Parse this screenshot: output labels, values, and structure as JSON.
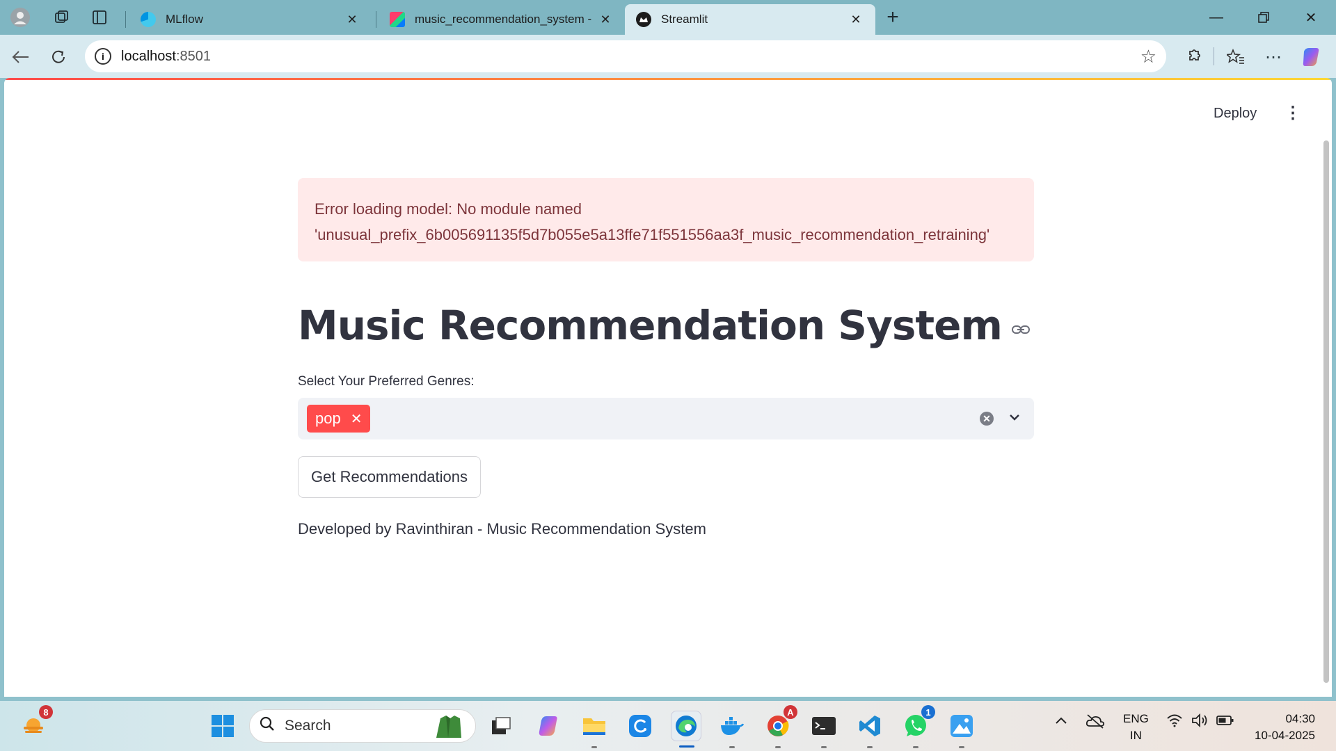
{
  "browser": {
    "tabs": [
      {
        "label": "MLflow",
        "active": false,
        "close": "✕"
      },
      {
        "label": "music_recommendation_system -",
        "active": false,
        "close": "✕"
      },
      {
        "label": "Streamlit",
        "active": true,
        "close": "✕"
      }
    ],
    "new_tab": "+",
    "address_host": "localhost",
    "address_port": ":8501"
  },
  "app": {
    "deploy_label": "Deploy",
    "error_line1": "Error loading model: No module named",
    "error_line2": "'unusual_prefix_6b005691135f5d7b055e5a13ffe71f551556aa3f_music_recommendation_retraining'",
    "title": "Music Recommendation System",
    "genre_label": "Select Your Preferred Genres:",
    "selected_genres": [
      "pop"
    ],
    "button_label": "Get Recommendations",
    "footer": "Developed by Ravinthiran - Music Recommendation System",
    "colors": {
      "accent": "#ff4b4b",
      "error_bg": "#ffeaea",
      "error_text": "#7d353b"
    }
  },
  "taskbar": {
    "search_placeholder": "Search",
    "weather_badge": "8",
    "chrome_badge": "A",
    "whatsapp_badge": "1",
    "lang_top": "ENG",
    "lang_bottom": "IN",
    "time": "04:30",
    "date": "10-04-2025"
  }
}
